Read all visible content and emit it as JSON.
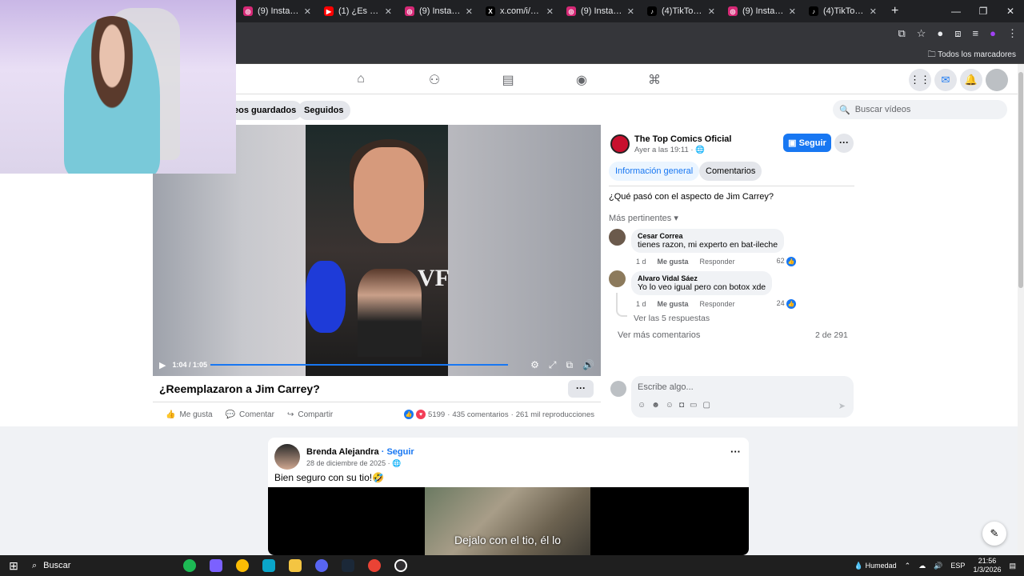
{
  "browser": {
    "tabs": [
      {
        "icon": "instagram-icon",
        "label": "(9) Instagram",
        "color": "#d62976"
      },
      {
        "icon": "youtube-icon",
        "label": "(1) ¿Es el origi...",
        "color": "#ff0000"
      },
      {
        "icon": "instagram-icon",
        "label": "(9) Instagram",
        "color": "#d62976"
      },
      {
        "icon": "x-icon",
        "label": "x.com/i/status/...",
        "color": "#000000"
      },
      {
        "icon": "instagram-icon",
        "label": "(9) Instagram",
        "color": "#d62976"
      },
      {
        "icon": "tiktok-icon",
        "label": "(4)TikTok - Ma...",
        "color": "#000000"
      },
      {
        "icon": "instagram-icon",
        "label": "(9) Instagram",
        "color": "#d62976"
      },
      {
        "icon": "tiktok-icon",
        "label": "(4)TikTok - Ma...",
        "color": "#000000"
      }
    ],
    "bookmarks_label": "Todos los marcadores"
  },
  "subnav": {
    "saved_videos": "eos guardados",
    "following": "Seguidos",
    "search_placeholder": "Buscar vídeos"
  },
  "video": {
    "time": "1:04 / 1:05",
    "progress": 0.98,
    "title": "¿Reemplazaron a Jim Carrey?",
    "like_label": "Me gusta",
    "comment_label": "Comentar",
    "share_label": "Compartir",
    "reactions": "5199",
    "comments": "435 comentarios",
    "views": "261 mil reproducciones"
  },
  "page": {
    "name": "The Top Comics Oficial",
    "time": "Ayer a las 19:11 ·",
    "follow_label": "Seguir",
    "tab_info": "Información general",
    "tab_comments": "Comentarios",
    "question": "¿Qué pasó con el aspecto de Jim Carrey?",
    "sort_label": "Más pertinentes",
    "comments": [
      {
        "author": "Cesar Correa",
        "text": "tienes razon, mi experto en bat-ileche",
        "age": "1 d",
        "like": "Me gusta",
        "reply": "Responder",
        "count": "62"
      },
      {
        "author": "Alvaro Vidal Sáez",
        "text": "Yo lo veo igual pero con botox xde",
        "age": "1 d",
        "like": "Me gusta",
        "reply": "Responder",
        "count": "24"
      }
    ],
    "see_replies": "Ver las 5 respuestas",
    "see_more": "Ver más comentarios",
    "comment_count": "2 de 291",
    "composer_placeholder": "Escribe algo..."
  },
  "post": {
    "author": "Brenda Alejandra",
    "follow_label": "· Seguir",
    "date": "28 de diciembre de 2025 ·",
    "text": "Bien seguro con su tio!🤣",
    "caption": "Dejalo con el tio, él lo"
  },
  "taskbar": {
    "search_label": "Buscar",
    "weather": "Humedad",
    "lang": "ESP",
    "time": "21:56",
    "date": "1/3/2026"
  }
}
